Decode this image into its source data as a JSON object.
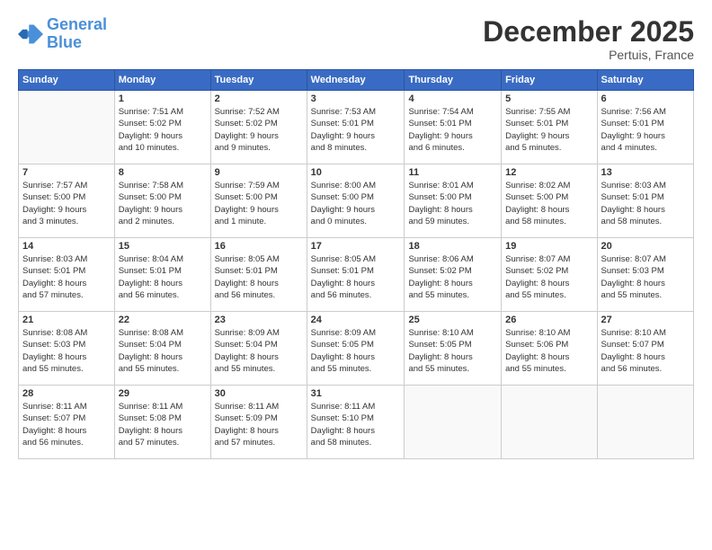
{
  "header": {
    "logo_line1": "General",
    "logo_line2": "Blue",
    "month": "December 2025",
    "location": "Pertuis, France"
  },
  "weekdays": [
    "Sunday",
    "Monday",
    "Tuesday",
    "Wednesday",
    "Thursday",
    "Friday",
    "Saturday"
  ],
  "weeks": [
    [
      {
        "day": "",
        "info": ""
      },
      {
        "day": "1",
        "info": "Sunrise: 7:51 AM\nSunset: 5:02 PM\nDaylight: 9 hours\nand 10 minutes."
      },
      {
        "day": "2",
        "info": "Sunrise: 7:52 AM\nSunset: 5:02 PM\nDaylight: 9 hours\nand 9 minutes."
      },
      {
        "day": "3",
        "info": "Sunrise: 7:53 AM\nSunset: 5:01 PM\nDaylight: 9 hours\nand 8 minutes."
      },
      {
        "day": "4",
        "info": "Sunrise: 7:54 AM\nSunset: 5:01 PM\nDaylight: 9 hours\nand 6 minutes."
      },
      {
        "day": "5",
        "info": "Sunrise: 7:55 AM\nSunset: 5:01 PM\nDaylight: 9 hours\nand 5 minutes."
      },
      {
        "day": "6",
        "info": "Sunrise: 7:56 AM\nSunset: 5:01 PM\nDaylight: 9 hours\nand 4 minutes."
      }
    ],
    [
      {
        "day": "7",
        "info": "Sunrise: 7:57 AM\nSunset: 5:00 PM\nDaylight: 9 hours\nand 3 minutes."
      },
      {
        "day": "8",
        "info": "Sunrise: 7:58 AM\nSunset: 5:00 PM\nDaylight: 9 hours\nand 2 minutes."
      },
      {
        "day": "9",
        "info": "Sunrise: 7:59 AM\nSunset: 5:00 PM\nDaylight: 9 hours\nand 1 minute."
      },
      {
        "day": "10",
        "info": "Sunrise: 8:00 AM\nSunset: 5:00 PM\nDaylight: 9 hours\nand 0 minutes."
      },
      {
        "day": "11",
        "info": "Sunrise: 8:01 AM\nSunset: 5:00 PM\nDaylight: 8 hours\nand 59 minutes."
      },
      {
        "day": "12",
        "info": "Sunrise: 8:02 AM\nSunset: 5:00 PM\nDaylight: 8 hours\nand 58 minutes."
      },
      {
        "day": "13",
        "info": "Sunrise: 8:03 AM\nSunset: 5:01 PM\nDaylight: 8 hours\nand 58 minutes."
      }
    ],
    [
      {
        "day": "14",
        "info": "Sunrise: 8:03 AM\nSunset: 5:01 PM\nDaylight: 8 hours\nand 57 minutes."
      },
      {
        "day": "15",
        "info": "Sunrise: 8:04 AM\nSunset: 5:01 PM\nDaylight: 8 hours\nand 56 minutes."
      },
      {
        "day": "16",
        "info": "Sunrise: 8:05 AM\nSunset: 5:01 PM\nDaylight: 8 hours\nand 56 minutes."
      },
      {
        "day": "17",
        "info": "Sunrise: 8:05 AM\nSunset: 5:01 PM\nDaylight: 8 hours\nand 56 minutes."
      },
      {
        "day": "18",
        "info": "Sunrise: 8:06 AM\nSunset: 5:02 PM\nDaylight: 8 hours\nand 55 minutes."
      },
      {
        "day": "19",
        "info": "Sunrise: 8:07 AM\nSunset: 5:02 PM\nDaylight: 8 hours\nand 55 minutes."
      },
      {
        "day": "20",
        "info": "Sunrise: 8:07 AM\nSunset: 5:03 PM\nDaylight: 8 hours\nand 55 minutes."
      }
    ],
    [
      {
        "day": "21",
        "info": "Sunrise: 8:08 AM\nSunset: 5:03 PM\nDaylight: 8 hours\nand 55 minutes."
      },
      {
        "day": "22",
        "info": "Sunrise: 8:08 AM\nSunset: 5:04 PM\nDaylight: 8 hours\nand 55 minutes."
      },
      {
        "day": "23",
        "info": "Sunrise: 8:09 AM\nSunset: 5:04 PM\nDaylight: 8 hours\nand 55 minutes."
      },
      {
        "day": "24",
        "info": "Sunrise: 8:09 AM\nSunset: 5:05 PM\nDaylight: 8 hours\nand 55 minutes."
      },
      {
        "day": "25",
        "info": "Sunrise: 8:10 AM\nSunset: 5:05 PM\nDaylight: 8 hours\nand 55 minutes."
      },
      {
        "day": "26",
        "info": "Sunrise: 8:10 AM\nSunset: 5:06 PM\nDaylight: 8 hours\nand 55 minutes."
      },
      {
        "day": "27",
        "info": "Sunrise: 8:10 AM\nSunset: 5:07 PM\nDaylight: 8 hours\nand 56 minutes."
      }
    ],
    [
      {
        "day": "28",
        "info": "Sunrise: 8:11 AM\nSunset: 5:07 PM\nDaylight: 8 hours\nand 56 minutes."
      },
      {
        "day": "29",
        "info": "Sunrise: 8:11 AM\nSunset: 5:08 PM\nDaylight: 8 hours\nand 57 minutes."
      },
      {
        "day": "30",
        "info": "Sunrise: 8:11 AM\nSunset: 5:09 PM\nDaylight: 8 hours\nand 57 minutes."
      },
      {
        "day": "31",
        "info": "Sunrise: 8:11 AM\nSunset: 5:10 PM\nDaylight: 8 hours\nand 58 minutes."
      },
      {
        "day": "",
        "info": ""
      },
      {
        "day": "",
        "info": ""
      },
      {
        "day": "",
        "info": ""
      }
    ]
  ]
}
